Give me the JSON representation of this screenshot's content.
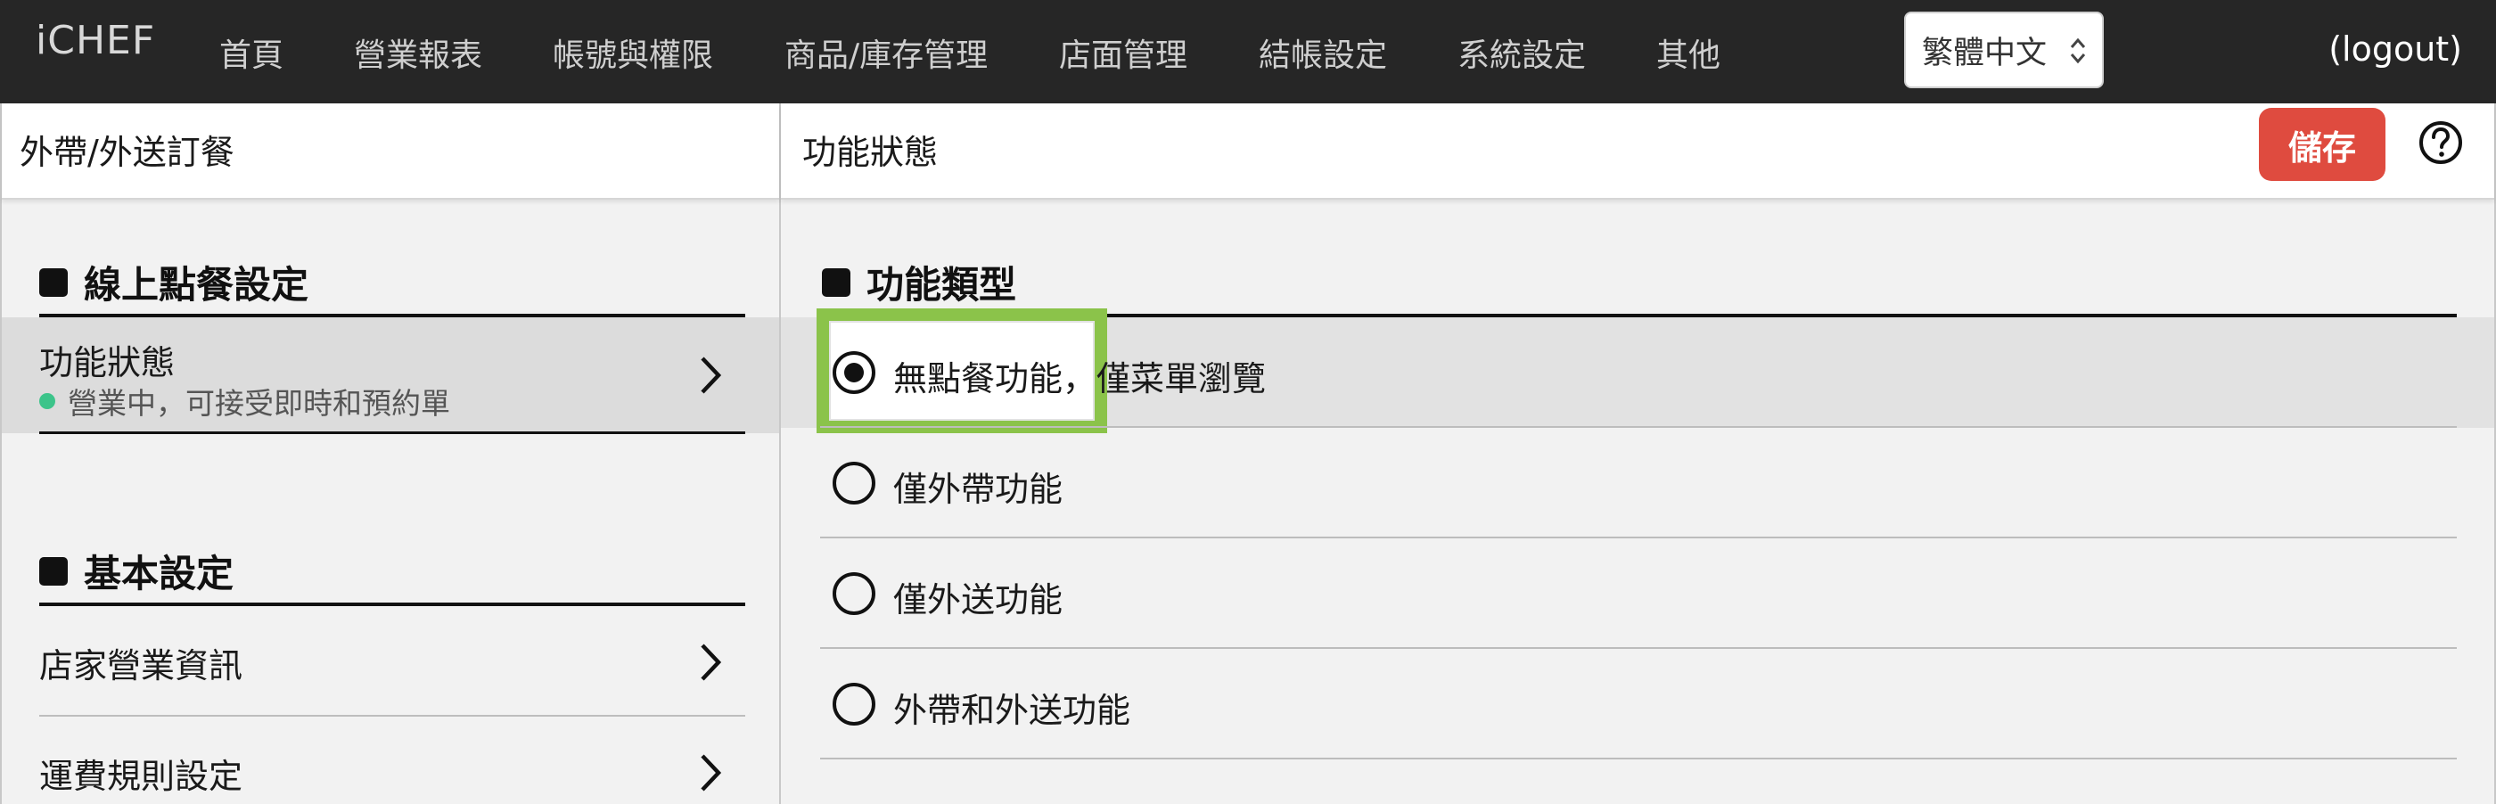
{
  "app": {
    "logo": "iCHEF",
    "logout_label": "(logout)"
  },
  "nav": {
    "items": [
      "首頁",
      "營業報表",
      "帳號與權限",
      "商品/庫存管理",
      "店面管理",
      "結帳設定",
      "系統設定",
      "其他"
    ],
    "language": "繁體中文"
  },
  "left_panel": {
    "title": "外帶/外送訂餐",
    "sections": [
      {
        "heading": "線上點餐設定",
        "items": [
          {
            "label": "功能狀態",
            "status": "營業中，可接受即時和預約單",
            "status_color": "#3cc48a"
          }
        ]
      },
      {
        "heading": "基本設定",
        "items": [
          {
            "label": "店家營業資訊"
          },
          {
            "label": "運費規則設定"
          }
        ]
      }
    ]
  },
  "right_panel": {
    "title": "功能狀態",
    "save_label": "儲存",
    "section_heading": "功能類型",
    "options": [
      {
        "label": "無點餐功能，僅菜單瀏覽",
        "selected": true
      },
      {
        "label": "僅外帶功能",
        "selected": false
      },
      {
        "label": "僅外送功能",
        "selected": false
      },
      {
        "label": "外帶和外送功能",
        "selected": false
      }
    ]
  },
  "colors": {
    "topbar": "#262626",
    "save_button": "#df4b3f",
    "highlight": "#8bc34a",
    "status_dot": "#3cc48a"
  },
  "icons": {
    "help": "question-circle-icon",
    "chevron": "chevron-right-icon",
    "select": "chevron-updown-icon"
  }
}
